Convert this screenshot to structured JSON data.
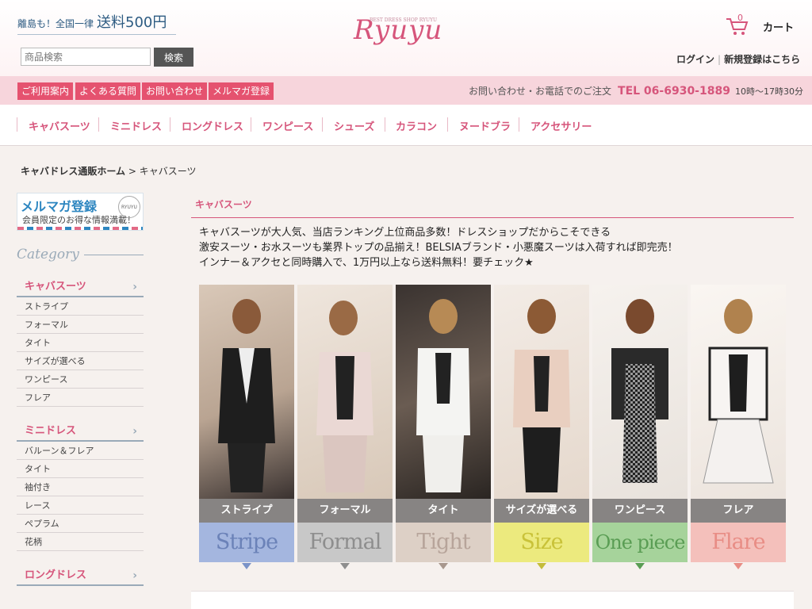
{
  "header": {
    "promo_prefix": "離島も！全国一律",
    "promo_main": "送料500円",
    "logo_text": "Ryuyu",
    "logo_tagline": "BEST DRESS SHOP RYUYU",
    "cart_count": "0",
    "cart_label": "カート",
    "search_placeholder": "商品検索",
    "search_button": "検索",
    "login": "ログイン",
    "register": "新規登録はこちら"
  },
  "subnav": {
    "items": [
      "ご利用案内",
      "よくある質問",
      "お問い合わせ",
      "メルマガ登録"
    ],
    "contact_text": "お問い合わせ・お電話でのご注文",
    "tel": "TEL 06-6930-1889",
    "hours": "10時～17時30分"
  },
  "category_nav": [
    "キャバスーツ",
    "ミニドレス",
    "ロングドレス",
    "ワンピース",
    "シューズ",
    "カラコン",
    "ヌードブラ",
    "アクセサリー"
  ],
  "breadcrumb": {
    "home": "キャバドレス通販ホーム",
    "separator": " > ",
    "current": "キャバスーツ"
  },
  "sidebar": {
    "mail_title": "メルマガ登録",
    "mail_sub": "会員限定のお得な情報満載！",
    "mail_stamp": "RYUYU",
    "category_title": "Category",
    "groups": [
      {
        "title": "キャバスーツ",
        "items": [
          "ストライプ",
          "フォーマル",
          "タイト",
          "サイズが選べる",
          "ワンピース",
          "フレア"
        ]
      },
      {
        "title": "ミニドレス",
        "items": [
          "バルーン＆フレア",
          "タイト",
          "袖付き",
          "レース",
          "ペプラム",
          "花柄"
        ]
      },
      {
        "title": "ロングドレス",
        "items": []
      }
    ]
  },
  "main": {
    "title": "キャバスーツ",
    "desc": [
      "キャバスーツが大人気、当店ランキング上位商品多数！ドレスショップだからこそできる",
      "激安スーツ・お水スーツも業界トップの品揃え！BELSIAブランド・小悪魔スーツは入荷すれば即完売！",
      "インナー＆アクセと同時購入で、1万円以上なら送料無料！要チェック★"
    ],
    "tiles": [
      {
        "jp": "ストライプ",
        "en": "Stripe",
        "color": "#a4b6df",
        "text_color": "#6b82b8",
        "arrow": "#7b93c8"
      },
      {
        "jp": "フォーマル",
        "en": "Formal",
        "color": "#c8c8c8",
        "text_color": "#8e8e8e",
        "arrow": "#8e8e8e"
      },
      {
        "jp": "タイト",
        "en": "Tight",
        "color": "#ddd0c6",
        "text_color": "#b7a49a",
        "arrow": "#a8978d"
      },
      {
        "jp": "サイズが選べる",
        "en": "Size",
        "color": "#ecea7e",
        "text_color": "#c9c239",
        "arrow": "#c4bc3a"
      },
      {
        "jp": "ワンピース",
        "en": "One piece",
        "color": "#a6d39b",
        "text_color": "#5a9d54",
        "arrow": "#5a9d54"
      },
      {
        "jp": "フレア",
        "en": "Flare",
        "color": "#f4c0bb",
        "text_color": "#e88d85",
        "arrow": "#e88d85"
      }
    ]
  },
  "colors": {
    "accent": "#d6557b",
    "accent_button": "#e5526f",
    "subbar": "#f7d5dc",
    "background": "#f6f1ee",
    "side_line": "#9aaab8"
  }
}
